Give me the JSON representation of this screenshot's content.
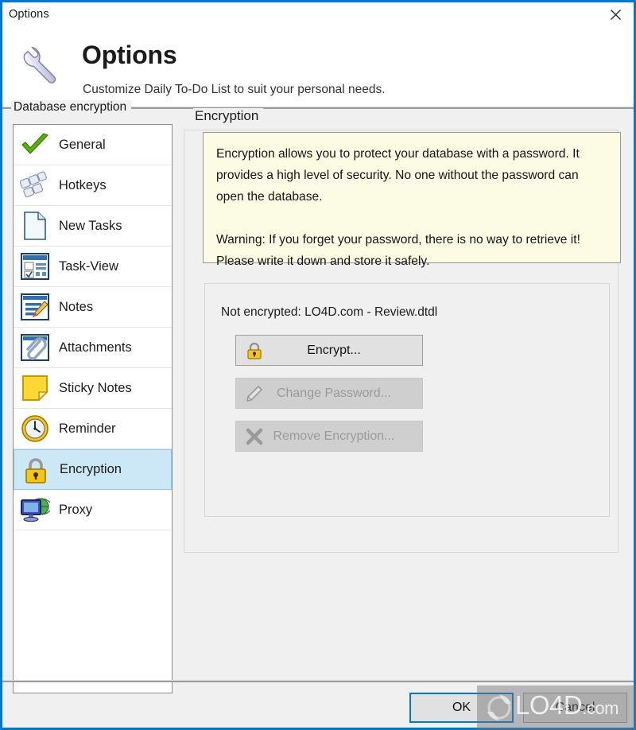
{
  "window": {
    "titlebar_text": "Options",
    "close_icon": "close-icon"
  },
  "header": {
    "icon": "wrench-icon",
    "title": "Options",
    "subtitle": "Customize Daily To-Do List to suit your personal needs."
  },
  "sidebar": {
    "items": [
      {
        "label": "General",
        "icon": "green-check-icon",
        "selected": false
      },
      {
        "label": "Hotkeys",
        "icon": "keyboard-keys-icon",
        "selected": false
      },
      {
        "label": "New Tasks",
        "icon": "document-icon",
        "selected": false
      },
      {
        "label": "Task-View",
        "icon": "task-list-icon",
        "selected": false
      },
      {
        "label": "Notes",
        "icon": "notes-pencil-icon",
        "selected": false
      },
      {
        "label": "Attachments",
        "icon": "paperclip-icon",
        "selected": false
      },
      {
        "label": "Sticky Notes",
        "icon": "sticky-note-icon",
        "selected": false
      },
      {
        "label": "Reminder",
        "icon": "clock-icon",
        "selected": false
      },
      {
        "label": "Encryption",
        "icon": "padlock-icon",
        "selected": true
      },
      {
        "label": "Proxy",
        "icon": "monitor-globe-icon",
        "selected": false
      }
    ]
  },
  "main": {
    "group_title": "Encryption",
    "info_paragraph_1": "Encryption allows you to protect your database with a password. It provides a high level of security. No one without the password can open the database.",
    "info_paragraph_2": "Warning: If you forget your password, there is no way to retrieve it! Please write it down and store it safely.",
    "db_group_title": "Database encryption",
    "db_status": "Not encrypted: LO4D.com - Review.dtdl",
    "buttons": {
      "encrypt": {
        "label": "Encrypt...",
        "icon": "padlock-icon",
        "disabled": false
      },
      "change_password": {
        "label": "Change Password...",
        "icon": "pencil-icon",
        "disabled": true
      },
      "remove_encryption": {
        "label": "Remove Encryption...",
        "icon": "x-mark-icon",
        "disabled": true
      }
    }
  },
  "footer": {
    "ok_label": "OK",
    "cancel_label": "Cancel"
  },
  "watermark": {
    "brand": "LO4D",
    "tld": ".com",
    "logo_icon": "refresh-arrows-icon"
  },
  "colors": {
    "window_border": "#0078d7",
    "selection": "#cce8f6",
    "info_background": "#fcfbe3",
    "panel_background": "#f0f0f0"
  }
}
